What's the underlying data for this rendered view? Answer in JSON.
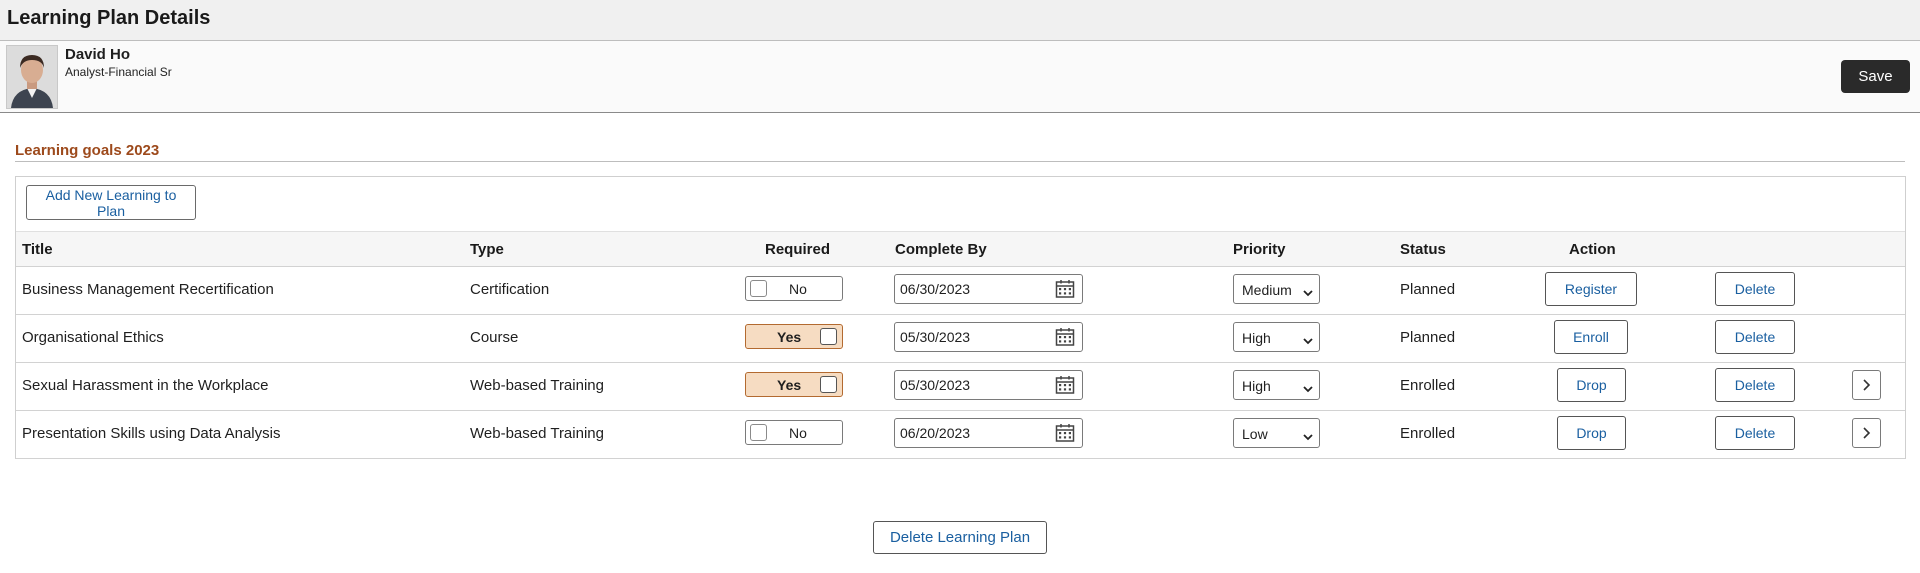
{
  "page": {
    "title": "Learning Plan Details"
  },
  "profile": {
    "name": "David Ho",
    "job_title": "Analyst-Financial Sr",
    "save_label": "Save"
  },
  "section": {
    "title": "Learning goals 2023"
  },
  "toolbar": {
    "add_label": "Add New Learning to Plan"
  },
  "table": {
    "headers": {
      "title": "Title",
      "type": "Type",
      "required": "Required",
      "complete_by": "Complete By",
      "priority": "Priority",
      "status": "Status",
      "action": "Action"
    },
    "rows": [
      {
        "title": "Business Management Recertification",
        "type": "Certification",
        "required": "No",
        "required_on": false,
        "complete_by": "06/30/2023",
        "priority": "Medium",
        "status": "Planned",
        "action": "Register",
        "delete": "Delete",
        "has_detail": false
      },
      {
        "title": "Organisational Ethics",
        "type": "Course",
        "required": "Yes",
        "required_on": true,
        "complete_by": "05/30/2023",
        "priority": "High",
        "status": "Planned",
        "action": "Enroll",
        "delete": "Delete",
        "has_detail": false
      },
      {
        "title": "Sexual Harassment in the Workplace",
        "type": "Web-based Training",
        "required": "Yes",
        "required_on": true,
        "complete_by": "05/30/2023",
        "priority": "High",
        "status": "Enrolled",
        "action": "Drop",
        "delete": "Delete",
        "has_detail": true
      },
      {
        "title": "Presentation Skills using Data Analysis",
        "type": "Web-based Training",
        "required": "No",
        "required_on": false,
        "complete_by": "06/20/2023",
        "priority": "Low",
        "status": "Enrolled",
        "action": "Drop",
        "delete": "Delete",
        "has_detail": true
      }
    ]
  },
  "footer": {
    "delete_plan_label": "Delete Learning Plan"
  },
  "colors": {
    "accent": "#9d4a1c",
    "link": "#1a5fa0",
    "toggle_on": "#f6dcc2",
    "save_bg": "#2a2a2a"
  }
}
